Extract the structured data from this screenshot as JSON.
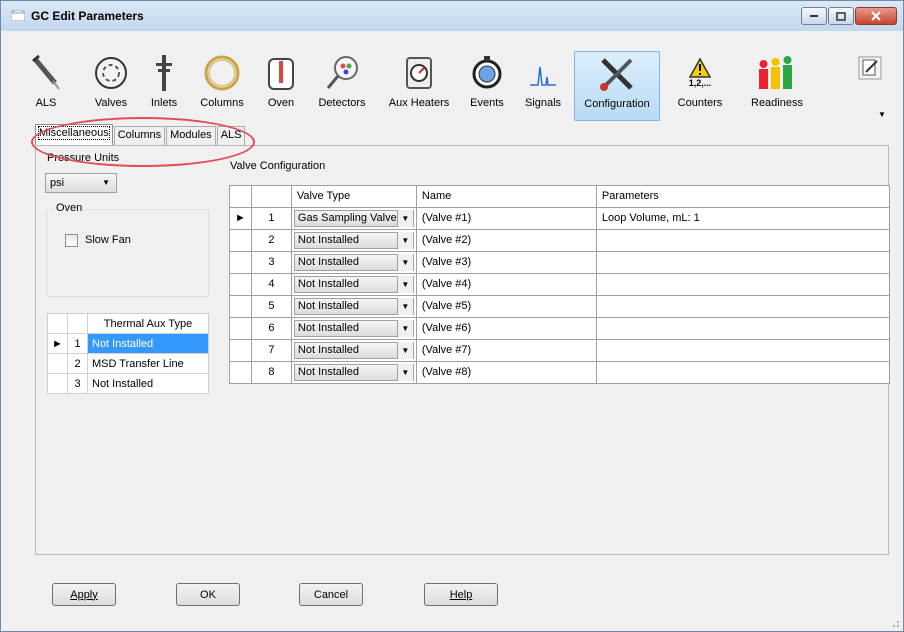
{
  "window": {
    "title": "GC Edit Parameters"
  },
  "toolbar": {
    "items": [
      {
        "label": "ALS",
        "icon": "syringe-icon"
      },
      {
        "label": "Valves",
        "icon": "valve-icon"
      },
      {
        "label": "Inlets",
        "icon": "inlet-icon"
      },
      {
        "label": "Columns",
        "icon": "column-coil-icon"
      },
      {
        "label": "Oven",
        "icon": "oven-thermometer-icon"
      },
      {
        "label": "Detectors",
        "icon": "detector-icon"
      },
      {
        "label": "Aux Heaters",
        "icon": "gauge-icon"
      },
      {
        "label": "Events",
        "icon": "stopwatch-icon"
      },
      {
        "label": "Signals",
        "icon": "chromatogram-icon"
      },
      {
        "label": "Configuration",
        "icon": "tools-icon"
      },
      {
        "label": "Counters",
        "icon": "warning-counter-icon",
        "overlay": "1,2,..."
      },
      {
        "label": "Readiness",
        "icon": "readiness-people-icon"
      }
    ],
    "selected": "Configuration"
  },
  "tabs": [
    "Miscellaneous",
    "Columns",
    "Modules",
    "ALS"
  ],
  "misc": {
    "pressure_units_label": "Pressure Units",
    "pressure_units_value": "psi",
    "oven_label": "Oven",
    "slow_fan_label": "Slow Fan",
    "slow_fan_checked": false,
    "thermal_aux_header": "Thermal Aux Type",
    "thermal_aux_rows": [
      {
        "n": "1",
        "value": "Not Installed",
        "selected": true
      },
      {
        "n": "2",
        "value": "MSD Transfer Line",
        "selected": false
      },
      {
        "n": "3",
        "value": "Not Installed",
        "selected": false
      }
    ]
  },
  "valve_config": {
    "label": "Valve Configuration",
    "headers": [
      "Valve Type",
      "Name",
      "Parameters"
    ],
    "rows": [
      {
        "n": "1",
        "type": "Gas Sampling Valve",
        "name": "(Valve #1)",
        "params": "Loop Volume, mL: 1"
      },
      {
        "n": "2",
        "type": "Not Installed",
        "name": "(Valve #2)",
        "params": ""
      },
      {
        "n": "3",
        "type": "Not Installed",
        "name": "(Valve #3)",
        "params": ""
      },
      {
        "n": "4",
        "type": "Not Installed",
        "name": "(Valve #4)",
        "params": ""
      },
      {
        "n": "5",
        "type": "Not Installed",
        "name": "(Valve #5)",
        "params": ""
      },
      {
        "n": "6",
        "type": "Not Installed",
        "name": "(Valve #6)",
        "params": ""
      },
      {
        "n": "7",
        "type": "Not Installed",
        "name": "(Valve #7)",
        "params": ""
      },
      {
        "n": "8",
        "type": "Not Installed",
        "name": "(Valve #8)",
        "params": ""
      }
    ]
  },
  "buttons": {
    "apply": "Apply",
    "ok": "OK",
    "cancel": "Cancel",
    "help": "Help"
  },
  "colors": {
    "selection": "#3399ff",
    "annotation": "#e34b55"
  }
}
